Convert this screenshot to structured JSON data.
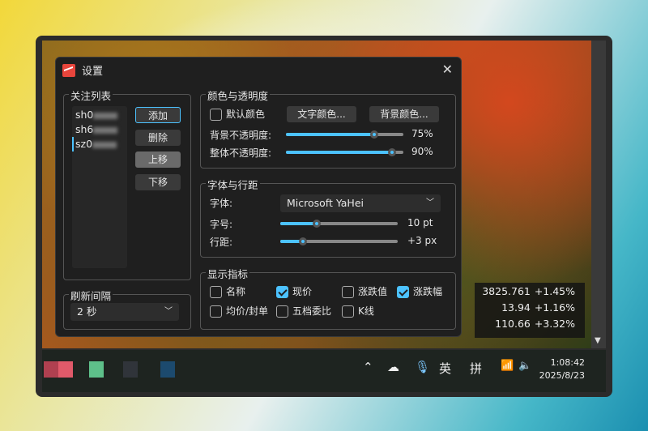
{
  "dialog": {
    "title": "设置",
    "close_label": "✕"
  },
  "watchlist": {
    "label": "关注列表",
    "items": [
      "sh0",
      "sh6",
      "sz0"
    ],
    "buttons": {
      "add": "添加",
      "delete": "删除",
      "up": "上移",
      "down": "下移"
    }
  },
  "refresh": {
    "label": "刷新间隔",
    "value": "2 秒"
  },
  "color": {
    "label": "颜色与透明度",
    "default_color": "默认颜色",
    "default_checked": false,
    "text_color_btn": "文字颜色...",
    "bg_color_btn": "背景颜色...",
    "bg_opacity_label": "背景不透明度:",
    "bg_opacity": 75,
    "bg_opacity_text": "75%",
    "overall_opacity_label": "整体不透明度:",
    "overall_opacity": 90,
    "overall_opacity_text": "90%"
  },
  "font": {
    "label": "字体与行距",
    "font_label": "字体:",
    "font_value": "Microsoft YaHei",
    "size_label": "字号:",
    "size_text": "10 pt",
    "size_fraction": 0.31,
    "spacing_label": "行距:",
    "spacing_text": "+3 px",
    "spacing_fraction": 0.19
  },
  "indicators": {
    "label": "显示指标",
    "items": [
      {
        "label": "名称",
        "checked": false
      },
      {
        "label": "现价",
        "checked": true
      },
      {
        "label": "涨跌值",
        "checked": false
      },
      {
        "label": "涨跌幅",
        "checked": true
      },
      {
        "label": "均价/封单",
        "checked": false
      },
      {
        "label": "五档委比",
        "checked": false
      },
      {
        "label": "K线",
        "checked": false
      }
    ]
  },
  "ticker": [
    {
      "value": "3825.761",
      "pct": "+1.45%"
    },
    {
      "value": "13.94",
      "pct": "+1.16%"
    },
    {
      "value": "110.66",
      "pct": "+3.32%"
    }
  ],
  "taskbar": {
    "ime1": "英",
    "ime2": "拼",
    "time": "1:08:42",
    "date": "2025/8/23"
  },
  "colors": {
    "accent": "#4cc2ff",
    "dialog_bg": "#1f1f1f"
  }
}
